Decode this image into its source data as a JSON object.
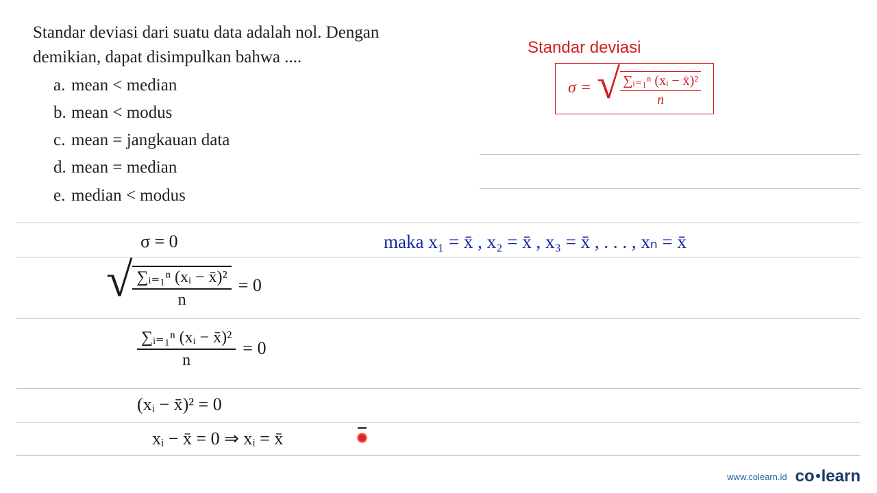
{
  "question": {
    "line1": "Standar deviasi dari suatu data adalah nol. Dengan",
    "line2": "demikian, dapat disimpulkan bahwa ....",
    "options": {
      "a": "mean < median",
      "b": "mean < modus",
      "c": "mean = jangkauan data",
      "d": "mean = median",
      "e": "median < modus"
    }
  },
  "formula": {
    "title": "Standar deviasi",
    "sigma": "σ =",
    "numerator": "∑ᵢ₌₁ⁿ (xᵢ − x̄)²",
    "denominator": "n"
  },
  "work": {
    "l1": "σ  =  0",
    "l2_eq": " =  0",
    "l2_num": "∑ᵢ₌₁ⁿ (xᵢ − x̄)²",
    "l2_den": "n",
    "l3_num": "∑ᵢ₌₁ⁿ (xᵢ − x̄)²",
    "l3_den": "n",
    "l3_eq": " =  0",
    "l4": "(xᵢ − x̄)²  =  0",
    "l5": "xᵢ − x̄  =  0    ⇒   xᵢ  =  x̄",
    "maka": "maka  x₁ = x̄ ,  x₂ = x̄ ,  x₃ = x̄ ,  . . . ,  xₙ = x̄"
  },
  "footer": {
    "site": "www.colearn.id",
    "brand1": "co",
    "brand2": "learn"
  }
}
